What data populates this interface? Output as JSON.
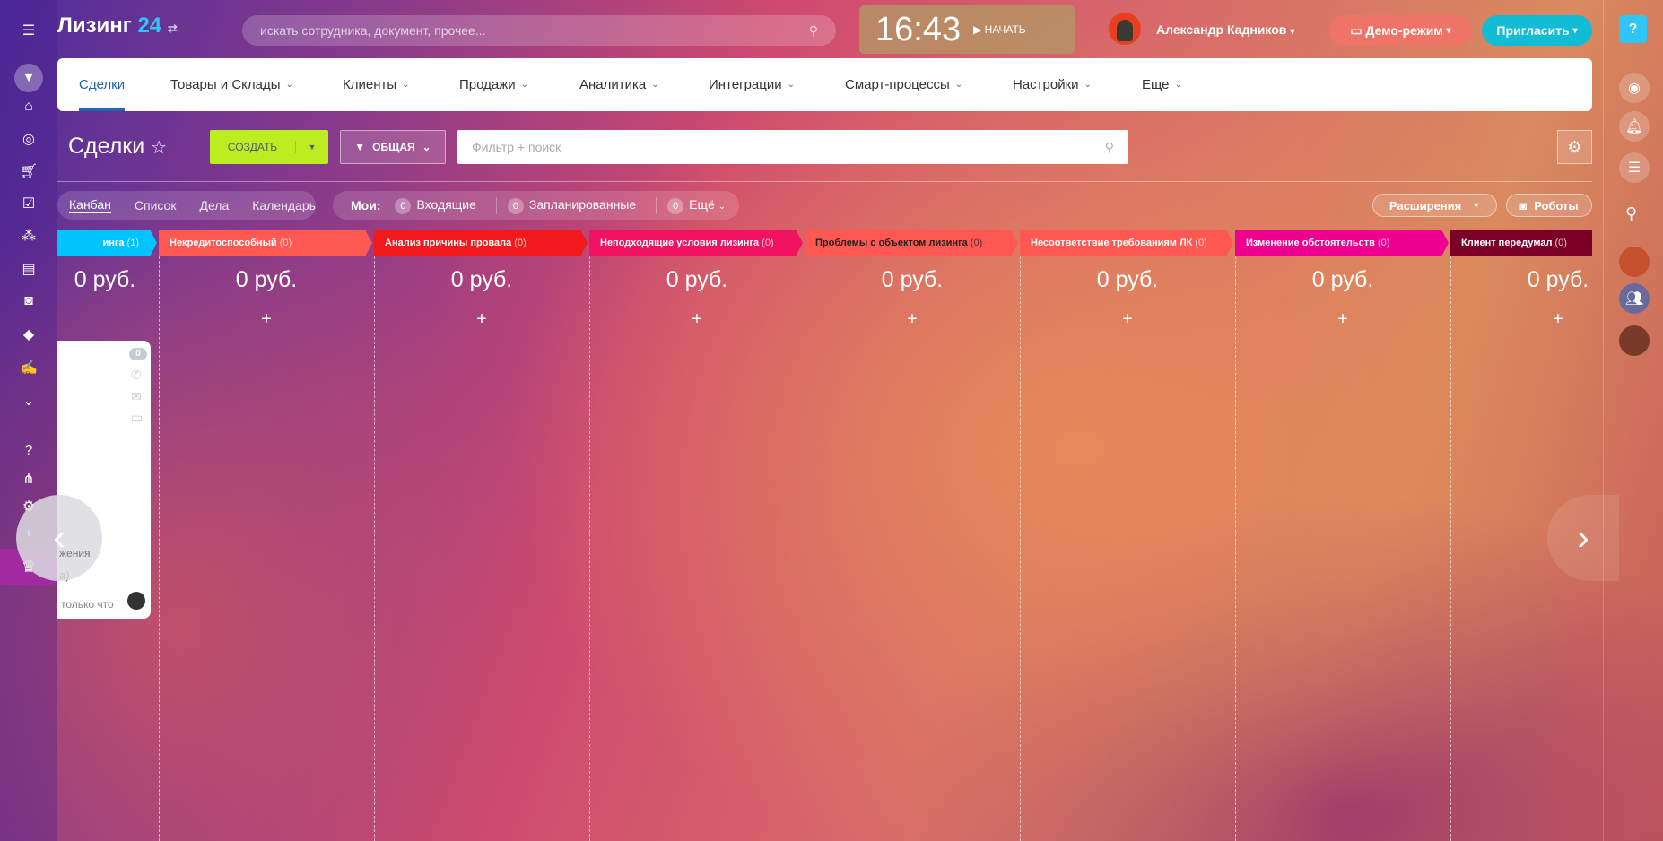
{
  "header": {
    "logo": "Лизинг",
    "logo_num": "24",
    "search_placeholder": "искать сотрудника, документ, прочее...",
    "time": "16:43",
    "start_label": "НАЧАТЬ",
    "user_name": "Александр Кадников",
    "demo_label": "Демо-режим",
    "invite_label": "Пригласить"
  },
  "nav": {
    "items": [
      {
        "label": "Сделки",
        "active": true
      },
      {
        "label": "Товары и Склады"
      },
      {
        "label": "Клиенты"
      },
      {
        "label": "Продажи"
      },
      {
        "label": "Аналитика"
      },
      {
        "label": "Интеграции"
      },
      {
        "label": "Смарт-процессы"
      },
      {
        "label": "Настройки"
      },
      {
        "label": "Еще"
      }
    ]
  },
  "toolbar": {
    "title": "Сделки",
    "create_label": "СОЗДАТЬ",
    "filter_preset": "ОБЩАЯ",
    "filter_placeholder": "Фильтр + поиск"
  },
  "views": {
    "tabs": [
      "Канбан",
      "Список",
      "Дела",
      "Календарь"
    ],
    "my_label": "Мои:",
    "counters": [
      {
        "count": "0",
        "label": "Входящие"
      },
      {
        "count": "0",
        "label": "Запланированные"
      },
      {
        "count": "0",
        "label": "Ещё"
      }
    ],
    "extensions_label": "Расширения",
    "robots_label": "Роботы"
  },
  "columns": [
    {
      "title": "инга",
      "count": "(1)",
      "color": "#00c4fb",
      "text": "#fff",
      "sum": "0 руб."
    },
    {
      "title": "Некредитоспособный",
      "count": "(0)",
      "color": "#ff5752",
      "text": "#fff",
      "sum": "0 руб."
    },
    {
      "title": "Анализ причины провала",
      "count": "(0)",
      "color": "#f1191b",
      "text": "#fff",
      "sum": "0 руб."
    },
    {
      "title": "Неподходящие условия лизинга",
      "count": "(0)",
      "color": "#f0125f",
      "text": "#fff",
      "sum": "0 руб."
    },
    {
      "title": "Проблемы с объектом лизинга",
      "count": "(0)",
      "color": "#ff5752",
      "text": "#222",
      "sum": "0 руб."
    },
    {
      "title": "Несоответствие требованиям ЛК",
      "count": "(0)",
      "color": "#ff5752",
      "text": "#fff",
      "sum": "0 руб."
    },
    {
      "title": "Изменение обстоятельств",
      "count": "(0)",
      "color": "#ee008f",
      "text": "#fff",
      "sum": "0 руб."
    },
    {
      "title": "Клиент передумал",
      "count": "(0)",
      "color": "#7b0027",
      "text": "#fff",
      "sum": "0 руб."
    }
  ],
  "column_add": "+",
  "card": {
    "badge": "0",
    "text1": "жения",
    "text2": "а)",
    "time": "только что"
  }
}
